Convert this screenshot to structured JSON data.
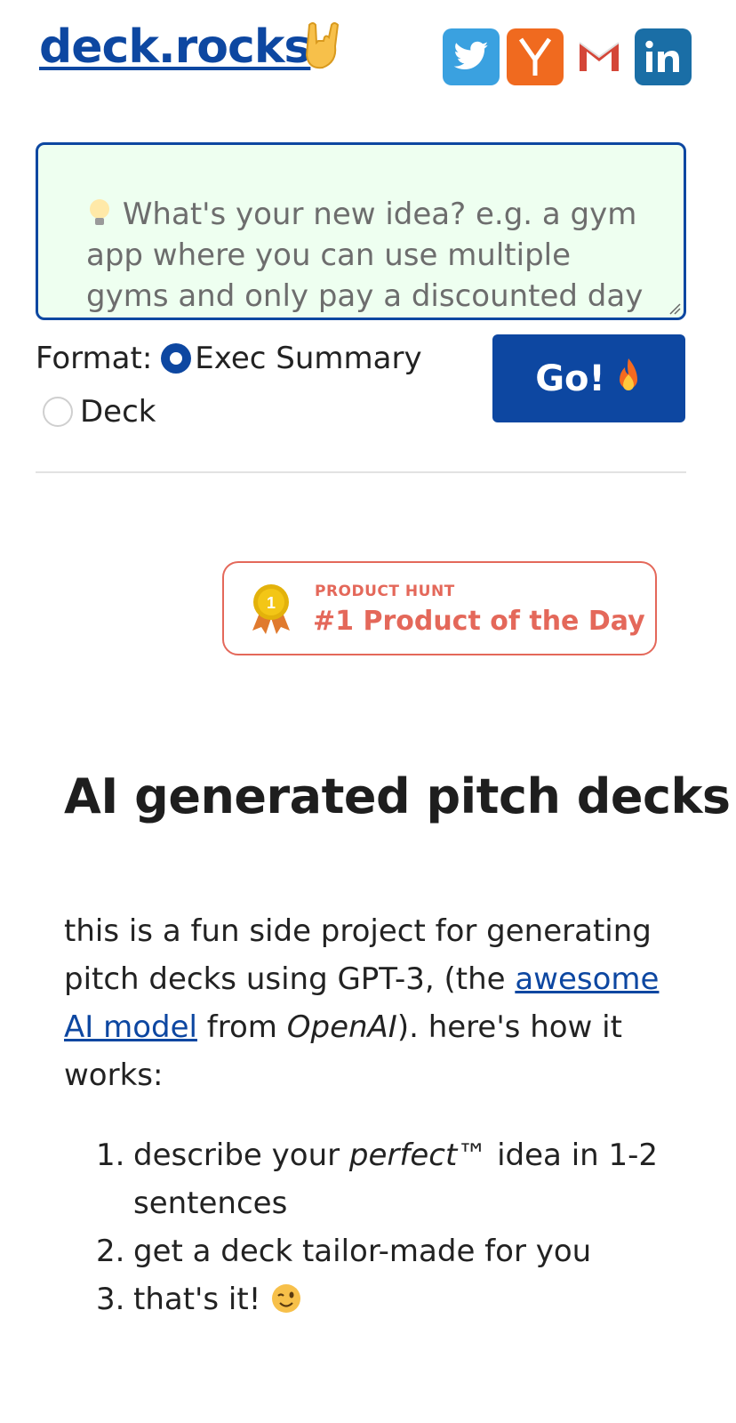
{
  "header": {
    "logo": "deck.rocks",
    "social": [
      {
        "name": "twitter-icon",
        "color": "#3aa1e0"
      },
      {
        "name": "ycombinator-icon",
        "color": "#f06a1f",
        "glyph": "Y"
      },
      {
        "name": "gmail-icon",
        "color": "#d44638"
      },
      {
        "name": "linkedin-icon",
        "color": "#1a6ea6",
        "glyph": "in"
      }
    ]
  },
  "form": {
    "idea_placeholder": "What's your new idea? e.g. a gym app where you can use multiple gyms and only pay a discounted day",
    "format_label": "Format:",
    "options": [
      {
        "label": "Exec Summary",
        "selected": true
      },
      {
        "label": "Deck",
        "selected": false
      }
    ],
    "go_label": "Go!"
  },
  "badge": {
    "kicker": "PRODUCT HUNT",
    "title": "#1 Product of the Day",
    "medal_number": "1"
  },
  "content": {
    "headline": "AI generated pitch decks!",
    "para_1": "this is a fun side project for generating pitch decks using GPT-3, (the ",
    "link": "awesome AI model",
    "para_2": " from ",
    "openai": "OpenAI",
    "para_3": "). here's how it works:",
    "steps": [
      {
        "num": "1.",
        "pre": "describe your ",
        "em": "perfect™",
        "post": " idea in 1-2 sentences"
      },
      {
        "num": "2.",
        "pre": "get a deck tailor-made for you",
        "em": "",
        "post": ""
      },
      {
        "num": "3.",
        "pre": "that's it! ",
        "em": "",
        "post": ""
      }
    ]
  },
  "colors": {
    "brand": "#0d47a1",
    "textarea_bg": "#eefff0",
    "badge": "#e4685a"
  }
}
